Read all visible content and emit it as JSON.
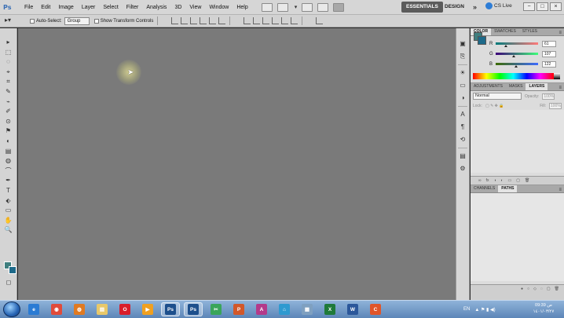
{
  "app": {
    "logo": "Ps"
  },
  "menubar": {
    "items": [
      "File",
      "Edit",
      "Image",
      "Layer",
      "Select",
      "Filter",
      "Analysis",
      "3D",
      "View",
      "Window",
      "Help"
    ],
    "zoom": "▾",
    "workspaces": {
      "essentials": "ESSENTIALS",
      "design": "DESIGN",
      "more": "»"
    },
    "cslive": "CS Live",
    "window_controls": [
      "−",
      "□",
      "×"
    ]
  },
  "options": {
    "auto_select_label": "Auto-Select:",
    "auto_select_value": "Group",
    "show_transform_label": "Show Transform Controls"
  },
  "tools": [
    "▸",
    "⬚",
    "◌",
    "⌖",
    "⌗",
    "✎",
    "⌁",
    "✐",
    "⊙",
    "⚑",
    "◐",
    "▤",
    "◍",
    "⌒",
    "✒",
    "T",
    "⬖",
    "▭",
    "✋",
    "🔍"
  ],
  "colors": {
    "foreground": "#3f7f7f",
    "background": "#1e6a8a"
  },
  "panels": {
    "color": {
      "tabs": [
        "COLOR",
        "SWATCHES",
        "STYLES"
      ],
      "sliders": [
        {
          "label": "R",
          "value": "61",
          "thumb": 0.24
        },
        {
          "label": "G",
          "value": "107",
          "thumb": 0.42
        },
        {
          "label": "B",
          "value": "122",
          "thumb": 0.48
        }
      ]
    },
    "layers": {
      "tabs": [
        "ADJUSTMENTS",
        "MASKS",
        "LAYERS"
      ],
      "blend_mode": "Normal",
      "opacity_label": "Opacity:",
      "opacity_value": "100%",
      "lock_label": "Lock:",
      "fill_label": "Fill:",
      "fill_value": "100%",
      "footer_icons": [
        "∞",
        "fx",
        "◑",
        "◐",
        "▭",
        "▢",
        "🗑"
      ]
    },
    "paths": {
      "tabs": [
        "CHANNELS",
        "PATHS"
      ],
      "footer_icons": [
        "●",
        "○",
        "◇",
        "◌",
        "▢",
        "🗑"
      ]
    }
  },
  "dock_icons": [
    "▣",
    "⎘",
    "☀",
    "▭",
    "◑",
    "A",
    "¶",
    "⟲",
    "▤",
    "⚙"
  ],
  "taskbar": {
    "apps": [
      {
        "name": "ie",
        "label": "e",
        "color": "#2a7bd4"
      },
      {
        "name": "chrome",
        "label": "◉",
        "color": "#e04b3a"
      },
      {
        "name": "firefox",
        "label": "◍",
        "color": "#e07a22"
      },
      {
        "name": "explorer",
        "label": "▤",
        "color": "#e8c86a"
      },
      {
        "name": "opera",
        "label": "O",
        "color": "#d91d2b"
      },
      {
        "name": "media",
        "label": "▶",
        "color": "#f0a020"
      },
      {
        "name": "photoshop-1",
        "label": "Ps",
        "color": "#1d4f8c"
      },
      {
        "name": "photoshop-2",
        "label": "Ps",
        "color": "#1d4f8c"
      },
      {
        "name": "snip",
        "label": "✂",
        "color": "#3aa55a"
      },
      {
        "name": "powerpoint",
        "label": "P",
        "color": "#d2582a"
      },
      {
        "name": "access",
        "label": "A",
        "color": "#b33a8a"
      },
      {
        "name": "network",
        "label": "⌂",
        "color": "#2f9ad0"
      },
      {
        "name": "calculator",
        "label": "▦",
        "color": "#7fa0c0"
      },
      {
        "name": "excel",
        "label": "X",
        "color": "#1f7a3a"
      },
      {
        "name": "word",
        "label": "W",
        "color": "#2b579a"
      },
      {
        "name": "camtasia",
        "label": "C",
        "color": "#e0552a"
      }
    ],
    "tray": {
      "lang": "EN",
      "icons": "▲ ⚑ ▮ ◀)"
    },
    "clock": {
      "time": "09:39 ص",
      "date": "١٤٠١/٠٣/٢٧"
    }
  }
}
